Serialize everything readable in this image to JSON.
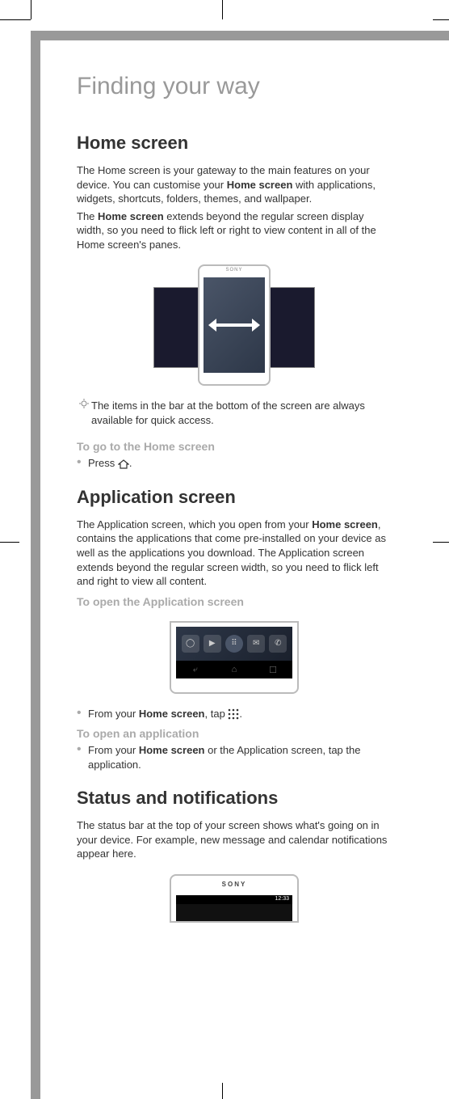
{
  "title": "Finding your way",
  "section1": {
    "heading": "Home screen",
    "para1_parts": [
      "The Home screen is your gateway to the main features on your device. You can customise your ",
      "Home screen",
      " with applications, widgets, shortcuts, folders, themes, and wallpaper."
    ],
    "para2_parts": [
      "The ",
      "Home screen",
      " extends beyond the regular screen display width, so you need to flick left or right to view content in all of the Home screen's panes."
    ],
    "tip": "The items in the bar at the bottom of the screen are always available for quick access.",
    "subheading1": "To go to the Home screen",
    "bullet1_prefix": "Press ",
    "bullet1_suffix": ".",
    "phone_label": "SONY"
  },
  "section2": {
    "heading": "Application screen",
    "para1_parts": [
      "The Application screen, which you open from your ",
      "Home screen",
      ", contains the applications that come pre-installed on your device as well as the applications you download. The Application screen extends beyond the regular screen width, so you need to flick left and right to view all content."
    ],
    "subheading1": "To open the Application screen",
    "bullet1_parts": [
      "From your ",
      "Home screen",
      ", tap "
    ],
    "bullet1_suffix": ".",
    "subheading2": "To open an application",
    "bullet2_parts": [
      "From your ",
      "Home screen",
      " or the Application screen, tap the application."
    ]
  },
  "section3": {
    "heading": "Status and notifications",
    "para1": "The status bar at the top of your screen shows what's going on in your device. For example, new message and calendar notifications appear here.",
    "phone_label": "SONY",
    "status_time": "12:33"
  }
}
